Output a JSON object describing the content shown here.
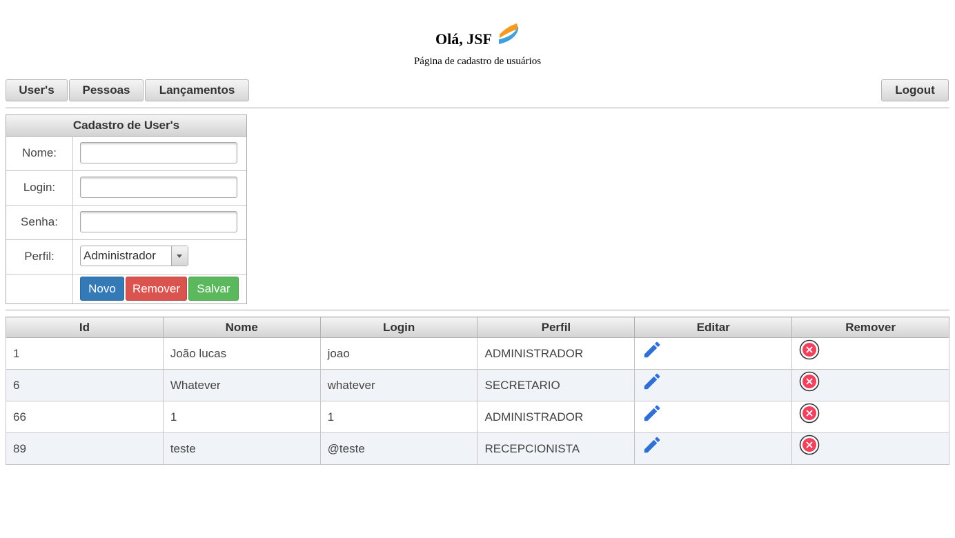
{
  "header": {
    "title": "Olá, JSF",
    "subtitle": "Página de cadastro de usuários"
  },
  "menu": {
    "users": "User's",
    "pessoas": "Pessoas",
    "lancamentos": "Lançamentos",
    "logout": "Logout"
  },
  "form": {
    "title": "Cadastro de User's",
    "nome_label": "Nome:",
    "nome_value": "",
    "login_label": "Login:",
    "login_value": "",
    "senha_label": "Senha:",
    "senha_value": "",
    "perfil_label": "Perfil:",
    "perfil_selected": "Administrador",
    "novo": "Novo",
    "remover": "Remover",
    "salvar": "Salvar"
  },
  "table": {
    "columns": [
      "Id",
      "Nome",
      "Login",
      "Perfil",
      "Editar",
      "Remover"
    ],
    "rows": [
      {
        "id": "1",
        "nome": "João lucas",
        "login": "joao",
        "perfil": "ADMINISTRADOR"
      },
      {
        "id": "6",
        "nome": "Whatever",
        "login": "whatever",
        "perfil": "SECRETARIO"
      },
      {
        "id": "66",
        "nome": "1",
        "login": "1",
        "perfil": "ADMINISTRADOR"
      },
      {
        "id": "89",
        "nome": "teste",
        "login": "@teste",
        "perfil": "RECEPCIONISTA"
      }
    ]
  },
  "colors": {
    "novo": "#337ab7",
    "remover": "#d9534f",
    "salvar": "#5cb85c",
    "edit_icon": "#2f6fd6",
    "remove_icon": "#f0415f"
  },
  "icons": {
    "logo": "jsf-logo-icon",
    "edit": "pencil-icon",
    "remove": "close-circle-icon",
    "dropdown": "caret-down-icon"
  }
}
